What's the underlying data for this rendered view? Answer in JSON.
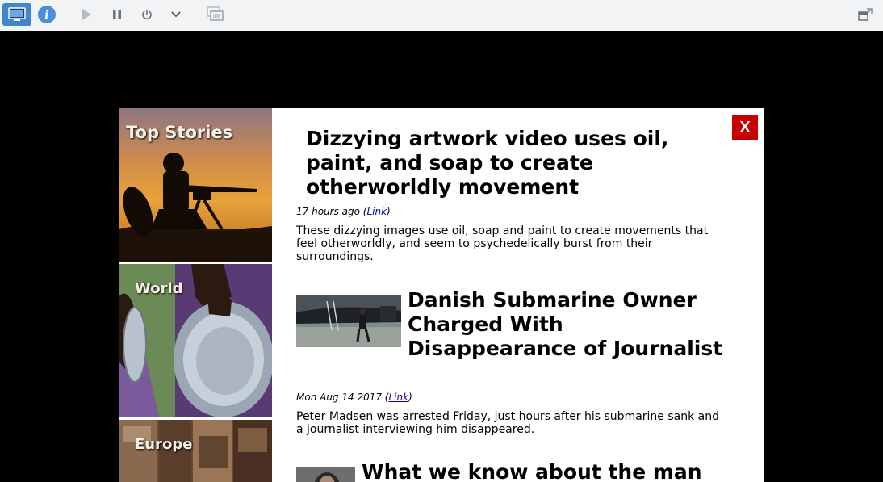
{
  "toolbar": {
    "icons": [
      "display-icon",
      "info-icon",
      "play-icon",
      "pause-icon",
      "power-icon",
      "chevron-down-icon",
      "snapshot-icon",
      "restore-window-icon"
    ],
    "active_color": "#3f86cf"
  },
  "sidebar": {
    "categories": [
      {
        "label": "Top Stories"
      },
      {
        "label": "World"
      },
      {
        "label": "Europe"
      }
    ]
  },
  "modal": {
    "close_label": "X",
    "close_color": "#c80000"
  },
  "articles": [
    {
      "title": "Dizzying artwork video uses oil, paint, and soap to create otherworldly movement",
      "time": "17 hours ago",
      "link_label": "Link",
      "summary": "These dizzying images use oil, soap and paint to create movements that feel otherworldly, and seem to psychedelically burst from their surroundings."
    },
    {
      "title": "Danish Submarine Owner Charged With Disappearance of Journalist",
      "time": "Mon Aug 14 2017",
      "link_label": "Link",
      "summary": "Peter Madsen was arrested Friday, just hours after his submarine sank and a journalist interviewing him disappeared."
    },
    {
      "title": "What we know about the man"
    }
  ]
}
